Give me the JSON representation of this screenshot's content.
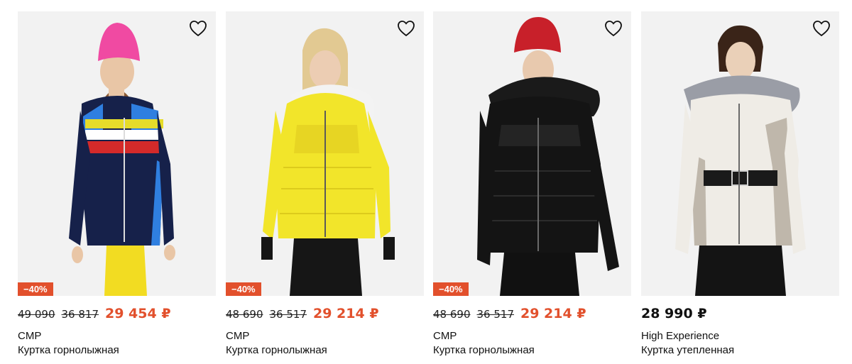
{
  "products": [
    {
      "brand": "CMP",
      "title": "Куртка горнолыжная",
      "discount": "−40%",
      "old_price_1": "49 090",
      "old_price_2": "36 817",
      "price": "29 454 ₽",
      "colors": {
        "hat": "#f04aa2",
        "jacket": "#16214a",
        "accent": "#2f7fe0",
        "stripe1": "#e6dc2a",
        "stripe2": "#d42a2a",
        "pants": "#f2dc22",
        "skin": "#e9c6a6",
        "hair": "#8a5a34"
      }
    },
    {
      "brand": "CMP",
      "title": "Куртка горнолыжная",
      "discount": "−40%",
      "old_price_1": "48 690",
      "old_price_2": "36 517",
      "price": "29 214 ₽",
      "colors": {
        "hat": "none",
        "jacket": "#f2e52a",
        "accent": "#e3cf1f",
        "stripe1": "#f2e52a",
        "stripe2": "#e7d523",
        "pants": "#161616",
        "skin": "#eccdb3",
        "hair": "#e2c992"
      }
    },
    {
      "brand": "CMP",
      "title": "Куртка горнолыжная",
      "discount": "−40%",
      "old_price_1": "48 690",
      "old_price_2": "36 517",
      "price": "29 214 ₽",
      "colors": {
        "hat": "#c8202a",
        "jacket": "#141414",
        "accent": "#2a2a2a",
        "stripe1": "#1c1c1c",
        "stripe2": "#242424",
        "pants": "#111111",
        "skin": "#e8c9ae",
        "hair": "#5a3b26"
      }
    },
    {
      "brand": "High Experience",
      "title": "Куртка утепленная",
      "discount": "",
      "price": "28 990 ₽",
      "colors": {
        "hat": "none",
        "jacket": "#efece6",
        "accent": "#bfb7ab",
        "stripe1": "#efece6",
        "stripe2": "#e3ded5",
        "pants": "#141414",
        "skin": "#ead0b8",
        "hair": "#3a2418"
      }
    }
  ]
}
